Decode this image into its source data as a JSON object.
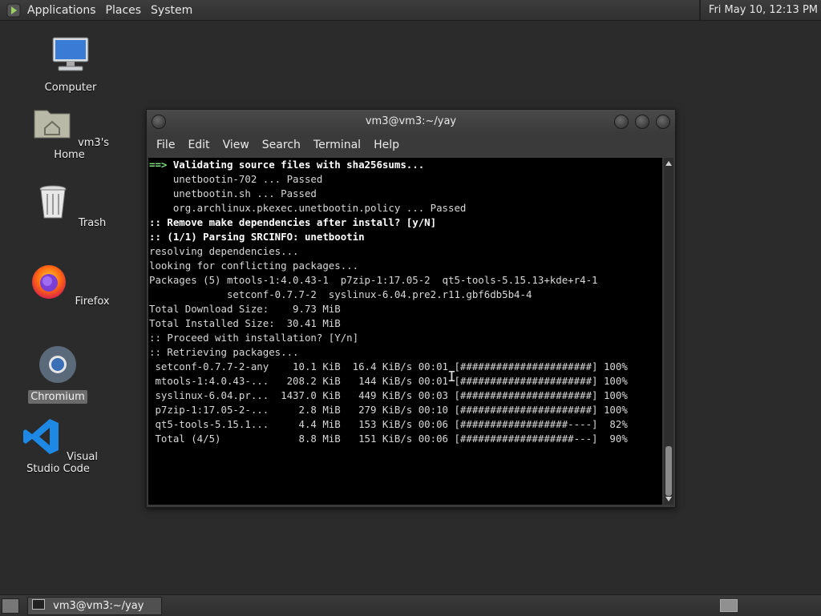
{
  "top_panel": {
    "menus": [
      "Applications",
      "Places",
      "System"
    ],
    "clock": "Fri May 10, 12:13 PM"
  },
  "desktop_icons": [
    {
      "label": "Computer"
    },
    {
      "label": "vm3's Home"
    },
    {
      "label": "Trash"
    },
    {
      "label": "Firefox"
    },
    {
      "label": "Chromium"
    },
    {
      "label": "Visual Studio Code"
    }
  ],
  "terminal": {
    "title": "vm3@vm3:~/yay",
    "menus": [
      "File",
      "Edit",
      "View",
      "Search",
      "Terminal",
      "Help"
    ],
    "lines": [
      {
        "prefix": "==> ",
        "text": "Validating source files with sha256sums...",
        "style": "bold"
      },
      {
        "text": "    unetbootin-702 ... Passed"
      },
      {
        "text": "    unetbootin.sh ... Passed"
      },
      {
        "text": "    org.archlinux.pkexec.unetbootin.policy ... Passed"
      },
      {
        "text": ":: Remove make dependencies after install? [y/N]",
        "style": "bold"
      },
      {
        "text": ":: (1/1) Parsing SRCINFO: unetbootin",
        "style": "bold"
      },
      {
        "text": "resolving dependencies..."
      },
      {
        "text": "looking for conflicting packages..."
      },
      {
        "text": ""
      },
      {
        "text": "Packages (5) mtools-1:4.0.43-1  p7zip-1:17.05-2  qt5-tools-5.15.13+kde+r4-1"
      },
      {
        "text": "             setconf-0.7.7-2  syslinux-6.04.pre2.r11.gbf6db5b4-4"
      },
      {
        "text": ""
      },
      {
        "text": "Total Download Size:    9.73 MiB"
      },
      {
        "text": "Total Installed Size:  30.41 MiB"
      },
      {
        "text": ""
      },
      {
        "text": ":: Proceed with installation? [Y/n]"
      },
      {
        "text": ":: Retrieving packages..."
      },
      {
        "text": " setconf-0.7.7-2-any    10.1 KiB  16.4 KiB/s 00:01 [######################] 100%"
      },
      {
        "text": " mtools-1:4.0.43-...   208.2 KiB   144 KiB/s 00:01 [######################] 100%"
      },
      {
        "text": " syslinux-6.04.pr...  1437.0 KiB   449 KiB/s 00:03 [######################] 100%"
      },
      {
        "text": " p7zip-1:17.05-2-...     2.8 MiB   279 KiB/s 00:10 [######################] 100%"
      },
      {
        "text": " qt5-tools-5.15.1...     4.4 MiB   153 KiB/s 00:06 [##################----]  82%"
      },
      {
        "text": " Total (4/5)             8.8 MiB   151 KiB/s 00:06 [###################---]  90%"
      }
    ]
  },
  "taskbar": {
    "task_label": "vm3@vm3:~/yay"
  }
}
